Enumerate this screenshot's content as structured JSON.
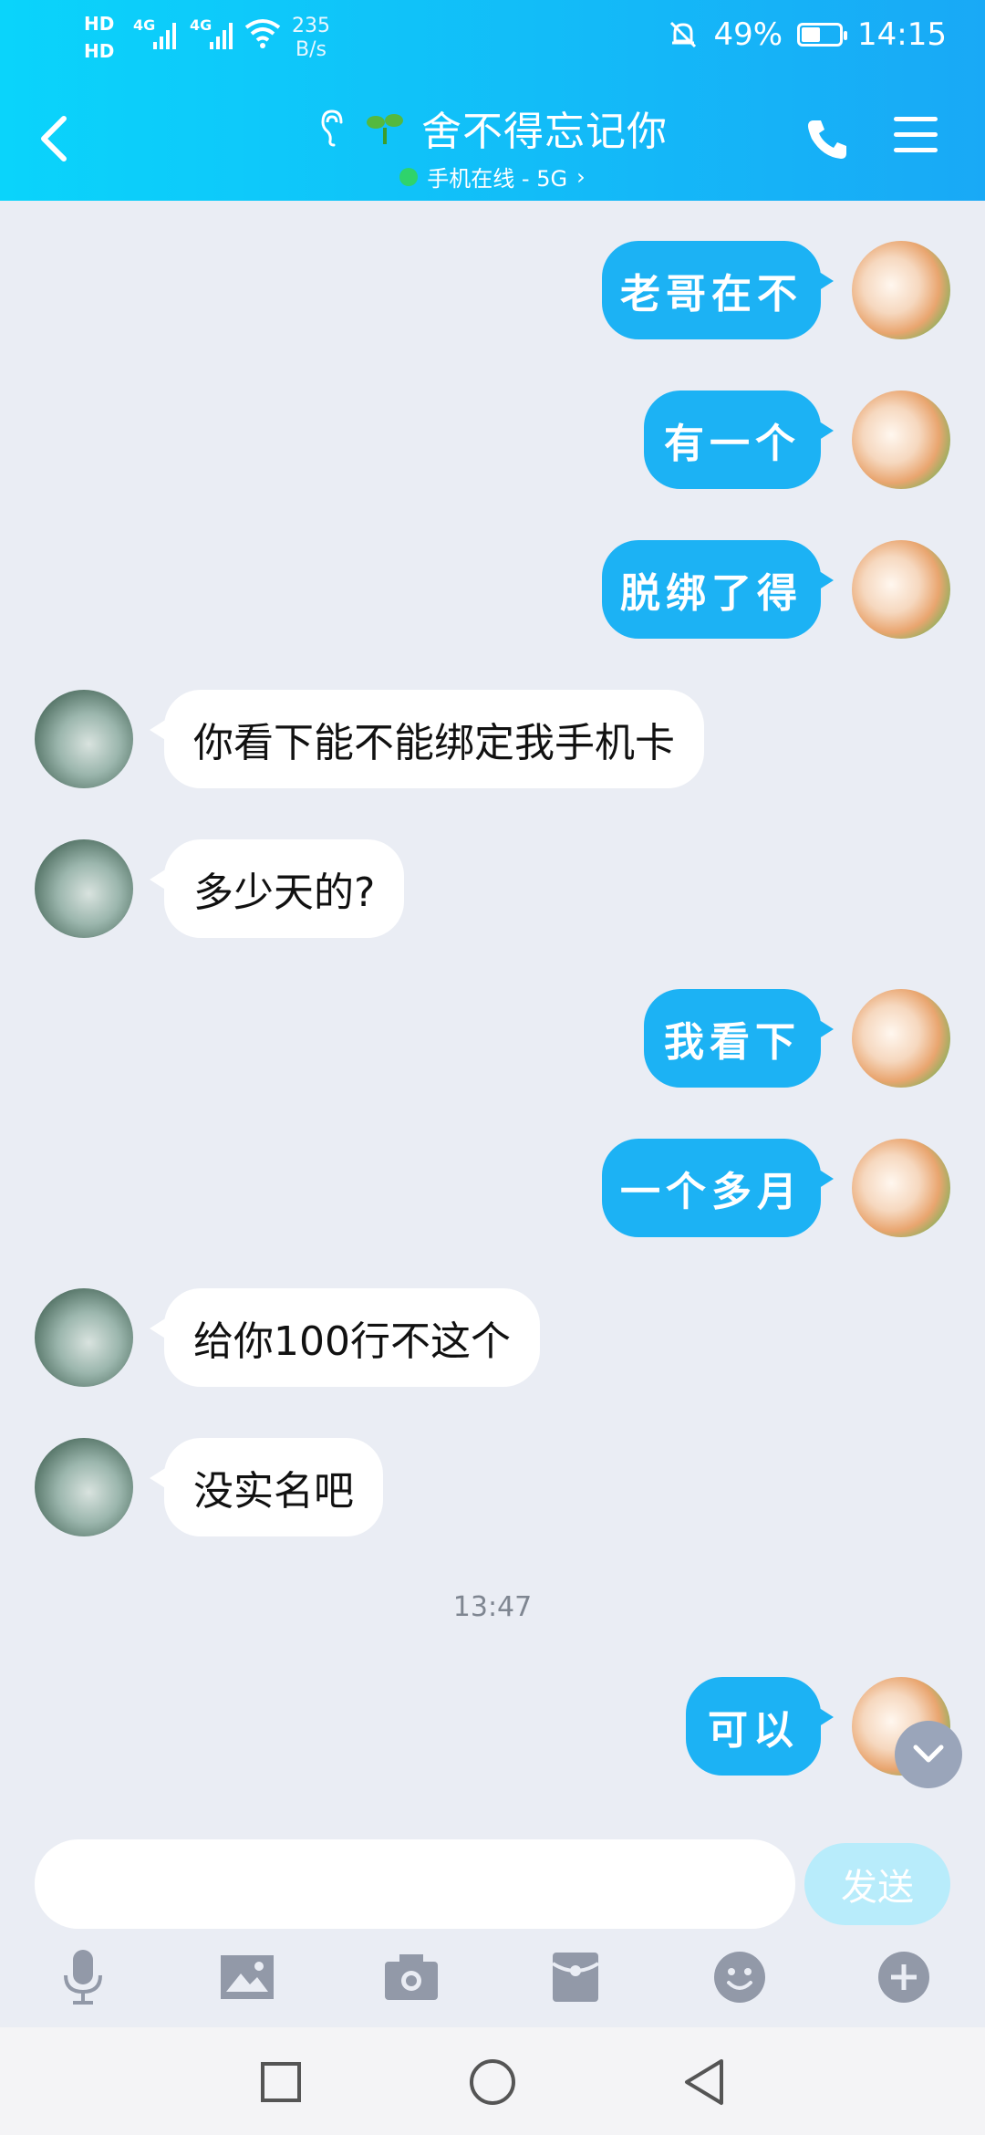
{
  "status_bar": {
    "hd1": "HD",
    "hd2": "HD",
    "net1": "4G",
    "net2": "4G",
    "speed_value": "235",
    "speed_unit": "B/s",
    "battery": "49%",
    "battery_level": 0.49,
    "time": "14:15"
  },
  "header": {
    "title": "舍不得忘记你",
    "subtitle": "手机在线 - 5G",
    "subtitle_chevron": "›"
  },
  "messages": [
    {
      "side": "me",
      "text": "老哥在不"
    },
    {
      "side": "me",
      "text": "有一个"
    },
    {
      "side": "me",
      "text": "脱绑了得"
    },
    {
      "side": "them",
      "text": "你看下能不能绑定我手机卡"
    },
    {
      "side": "them",
      "text": "多少天的?"
    },
    {
      "side": "me",
      "text": "我看下"
    },
    {
      "side": "me",
      "text": "一个多月"
    },
    {
      "side": "them",
      "text": "给你100行不这个"
    },
    {
      "side": "them",
      "text": "没实名吧"
    },
    {
      "side": "me",
      "text": "可以"
    }
  ],
  "time_divider": "13:47",
  "input": {
    "placeholder": "",
    "send_label": "发送"
  },
  "toolbar": {
    "icons": [
      "microphone-icon",
      "image-icon",
      "camera-icon",
      "red-packet-icon",
      "emoji-icon",
      "plus-icon"
    ]
  },
  "navbar": {
    "icons": [
      "recent-apps-icon",
      "home-icon",
      "back-icon"
    ]
  },
  "colors": {
    "header_start": "#0ad4fb",
    "header_end": "#19a9f6",
    "bubble_me": "#1cb2f4",
    "bubble_them": "#ffffff",
    "background": "#eaedf4",
    "send_disabled": "#b8ecfb"
  }
}
